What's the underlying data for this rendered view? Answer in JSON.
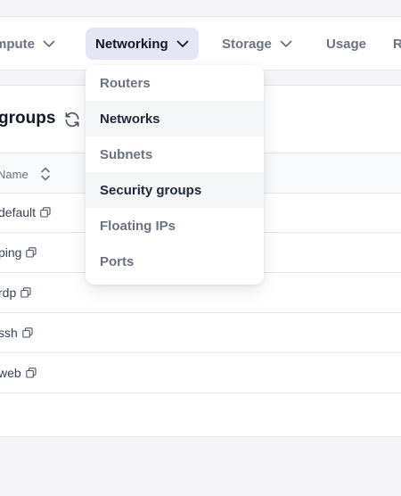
{
  "nav": {
    "items": [
      {
        "label": "mpute",
        "chevron": true
      },
      {
        "label": "Networking",
        "chevron": true,
        "active": true
      },
      {
        "label": "Storage",
        "chevron": true
      },
      {
        "label": "Usage",
        "chevron": false
      },
      {
        "label": "R",
        "chevron": false
      }
    ]
  },
  "dropdown": {
    "items": [
      {
        "label": "Routers",
        "highlighted": false
      },
      {
        "label": "Networks",
        "highlighted": true
      },
      {
        "label": "Subnets",
        "highlighted": false
      },
      {
        "label": "Security groups",
        "highlighted": true
      },
      {
        "label": "Floating IPs",
        "highlighted": false
      },
      {
        "label": "Ports",
        "highlighted": false
      }
    ]
  },
  "panel": {
    "title": "groups",
    "refresh_icon": "refresh-icon",
    "table": {
      "column_name": "Name",
      "rows": [
        "default",
        "ping",
        "rdp",
        "ssh",
        "web"
      ]
    }
  },
  "colors": {
    "active_nav_bg": "#e4e6f3",
    "menu_highlight_bg": "#f5f6f8",
    "page_bg": "#f5f5f7"
  }
}
